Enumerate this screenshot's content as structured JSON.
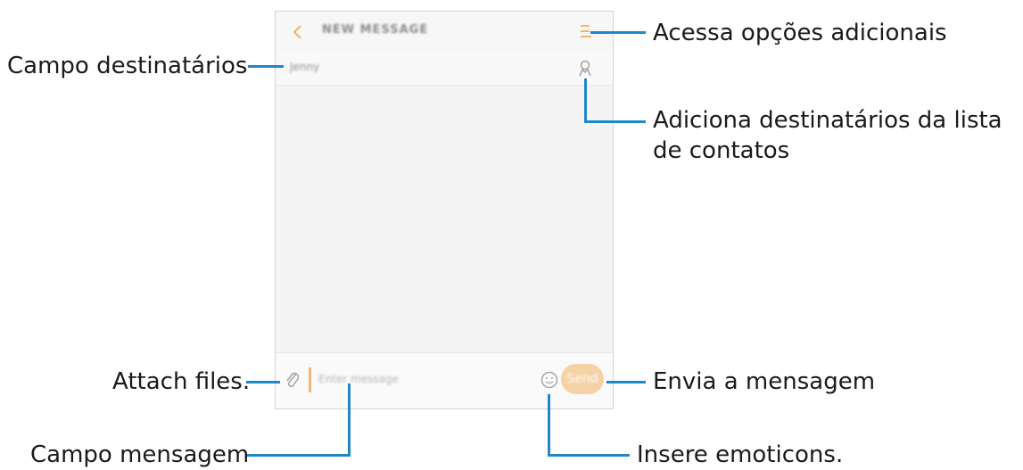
{
  "screen": {
    "title": "NEW MESSAGE",
    "recipient": "Jenny",
    "message_placeholder": "Enter message",
    "send_label": "Send"
  },
  "callouts": {
    "more_options": "Acessa opções adicionais",
    "recipients_field": "Campo destinatários",
    "add_from_contacts": "Adiciona destinatários da lista de contatos",
    "attach_files": "Attach files.",
    "send_message": "Envia a mensagem",
    "message_field": "Campo mensagem",
    "insert_emoticons": "Insere emoticons."
  },
  "colors": {
    "callout_line": "#1f86c7",
    "accent": "#f0b874",
    "send_button": "#f4d2a5"
  },
  "icons": {
    "back": "chevron-left-icon",
    "menu": "menu-lines-icon",
    "contact": "person-icon",
    "attach": "paperclip-icon",
    "emoticon": "smiley-icon"
  }
}
